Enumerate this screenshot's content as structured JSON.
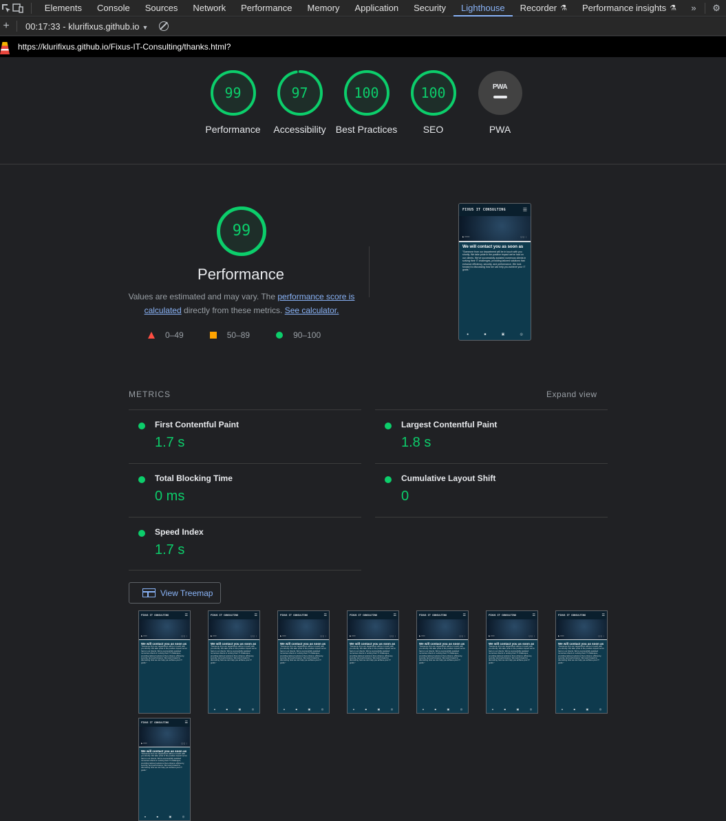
{
  "devtools": {
    "tabs": [
      {
        "label": "Elements"
      },
      {
        "label": "Console"
      },
      {
        "label": "Sources"
      },
      {
        "label": "Network"
      },
      {
        "label": "Performance"
      },
      {
        "label": "Memory"
      },
      {
        "label": "Application"
      },
      {
        "label": "Security"
      },
      {
        "label": "Lighthouse",
        "active": true
      },
      {
        "label": "Recorder",
        "experimental": true
      },
      {
        "label": "Performance insights",
        "experimental": true
      }
    ],
    "report_selector": "00:17:33 - klurifixus.github.io",
    "url": "https://klurifixus.github.io/Fixus-IT-Consulting/thanks.html?"
  },
  "gauges": [
    {
      "score": "99",
      "label": "Performance",
      "fraction": 0.99
    },
    {
      "score": "97",
      "label": "Accessibility",
      "fraction": 0.97
    },
    {
      "score": "100",
      "label": "Best Practices",
      "fraction": 1.0
    },
    {
      "score": "100",
      "label": "SEO",
      "fraction": 1.0
    }
  ],
  "pwa": {
    "badge": "PWA",
    "label": "PWA"
  },
  "performance": {
    "score": "99",
    "fraction": 0.99,
    "title": "Performance",
    "desc_prefix": "Values are estimated and may vary. The ",
    "desc_link1": "performance score is calculated",
    "desc_mid": " directly from these metrics. ",
    "desc_link2": "See calculator."
  },
  "legend": [
    {
      "range": "0–49"
    },
    {
      "range": "50–89"
    },
    {
      "range": "90–100"
    }
  ],
  "screenshot": {
    "brand": "FIXUS IT CONSULTING",
    "heading": "We will contact you as soon as",
    "body": "\"Someone from our department will be in touch with you shortly. We take pride in the positive impact we've had on our clients. We've successfully assisted numerous clients in solving their IT challenges, providing tailored solutions that enhance efficiency, security, and performance. We look forward to discussing how we can help you achieve your IT goals.\""
  },
  "metrics": {
    "header": "METRICS",
    "expand": "Expand view",
    "items": [
      {
        "title": "First Contentful Paint",
        "value": "1.7 s"
      },
      {
        "title": "Largest Contentful Paint",
        "value": "1.8 s"
      },
      {
        "title": "Total Blocking Time",
        "value": "0 ms"
      },
      {
        "title": "Cumulative Layout Shift",
        "value": "0"
      },
      {
        "title": "Speed Index",
        "value": "1.7 s"
      }
    ]
  },
  "treemap_button": "View Treemap",
  "colors": {
    "pass": "#0cce6b",
    "average": "#ffa400",
    "fail": "#ff4e42",
    "link": "#8ab4f8"
  }
}
